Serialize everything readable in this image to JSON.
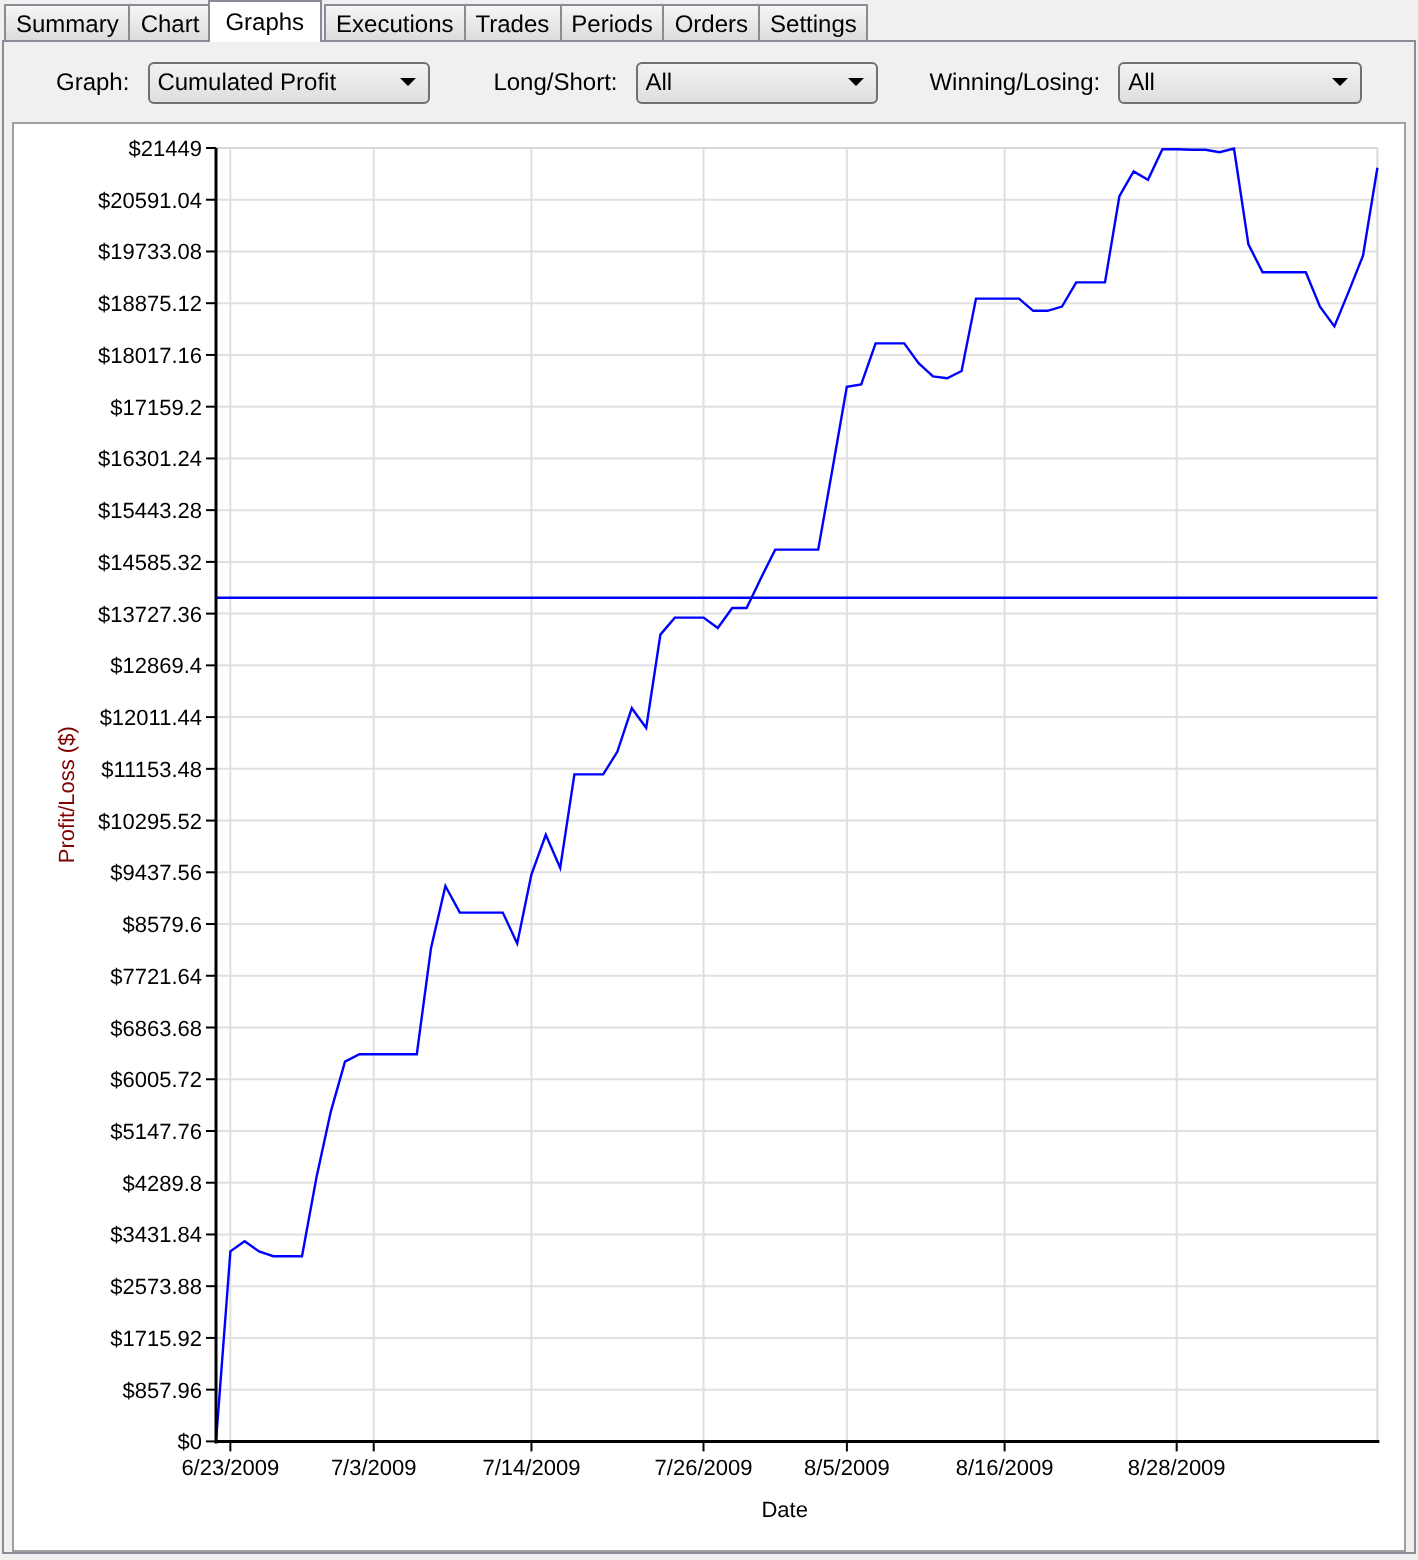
{
  "tabs": [
    {
      "label": "Summary",
      "selected": false
    },
    {
      "label": "Chart",
      "selected": false
    },
    {
      "label": "Graphs",
      "selected": true
    },
    {
      "label": "Executions",
      "selected": false
    },
    {
      "label": "Trades",
      "selected": false
    },
    {
      "label": "Periods",
      "selected": false
    },
    {
      "label": "Orders",
      "selected": false
    },
    {
      "label": "Settings",
      "selected": false
    }
  ],
  "filters": [
    {
      "label": "Graph:",
      "value": "Cumulated Profit"
    },
    {
      "label": "Long/Short:",
      "value": "All"
    },
    {
      "label": "Winning/Losing:",
      "value": "All"
    }
  ],
  "chart": {
    "chart_data": {
      "type": "line",
      "xlabel": "Date",
      "ylabel": "Profit/Loss ($)",
      "categories": [
        null,
        "6/23/2009",
        null,
        null,
        null,
        null,
        null,
        null,
        null,
        null,
        null,
        "7/3/2009",
        null,
        null,
        null,
        null,
        null,
        null,
        null,
        null,
        null,
        null,
        "7/14/2009",
        null,
        null,
        null,
        null,
        null,
        null,
        null,
        null,
        null,
        null,
        null,
        "7/26/2009",
        null,
        null,
        null,
        null,
        null,
        null,
        null,
        null,
        null,
        "8/5/2009",
        null,
        null,
        null,
        null,
        null,
        null,
        null,
        null,
        null,
        null,
        "8/16/2009",
        null,
        null,
        null,
        null,
        null,
        null,
        null,
        null,
        null,
        null,
        null,
        "8/28/2009",
        null,
        null,
        null,
        null,
        null,
        null,
        null,
        null,
        null,
        null,
        null,
        null,
        null,
        null
      ],
      "series": [
        {
          "color": "#0000ff",
          "values": [
            0,
            3150,
            3320,
            3150,
            3070,
            3070,
            3070,
            4370,
            5470,
            6300,
            6420,
            6420,
            6420,
            6420,
            6420,
            8180,
            9210,
            8770,
            8770,
            8770,
            8770,
            8260,
            9400,
            10060,
            9510,
            11060,
            11060,
            11060,
            11440,
            12160,
            11830,
            13380,
            13660,
            13660,
            13660,
            13490,
            13820,
            13820,
            14310,
            14790,
            14790,
            14790,
            14790,
            16140,
            17490,
            17530,
            18210,
            18210,
            18210,
            17880,
            17660,
            17630,
            17750,
            18950,
            18950,
            18950,
            18950,
            18750,
            18750,
            18820,
            19220,
            19220,
            19220,
            20650,
            21060,
            20920,
            21430,
            21430,
            21420,
            21420,
            21380,
            21440,
            19850,
            19390,
            19390,
            19390,
            19390,
            18820,
            18490,
            19070,
            19660,
            21120
          ]
        }
      ],
      "ylim": [
        0,
        21449
      ],
      "grid": true,
      "yticks": [
        {
          "value": 0,
          "label": "$0"
        },
        {
          "value": 857.96,
          "label": "$857.96"
        },
        {
          "value": 1715.92,
          "label": "$1715.92"
        },
        {
          "value": 2573.88,
          "label": "$2573.88"
        },
        {
          "value": 3431.84,
          "label": "$3431.84"
        },
        {
          "value": 4289.8,
          "label": "$4289.8"
        },
        {
          "value": 5147.76,
          "label": "$5147.76"
        },
        {
          "value": 6005.72,
          "label": "$6005.72"
        },
        {
          "value": 6863.68,
          "label": "$6863.68"
        },
        {
          "value": 7721.64,
          "label": "$7721.64"
        },
        {
          "value": 8579.6,
          "label": "$8579.6"
        },
        {
          "value": 9437.56,
          "label": "$9437.56"
        },
        {
          "value": 10295.52,
          "label": "$10295.52"
        },
        {
          "value": 11153.48,
          "label": "$11153.48"
        },
        {
          "value": 12011.44,
          "label": "$12011.44"
        },
        {
          "value": 12869.4,
          "label": "$12869.4"
        },
        {
          "value": 13727.36,
          "label": "$13727.36"
        },
        {
          "value": 14585.32,
          "label": "$14585.32"
        },
        {
          "value": 15443.28,
          "label": "$15443.28"
        },
        {
          "value": 16301.24,
          "label": "$16301.24"
        },
        {
          "value": 17159.2,
          "label": "$17159.2"
        },
        {
          "value": 18017.16,
          "label": "$18017.16"
        },
        {
          "value": 18875.12,
          "label": "$18875.12"
        },
        {
          "value": 19733.08,
          "label": "$19733.08"
        },
        {
          "value": 20591.04,
          "label": "$20591.04"
        },
        {
          "value": 21449,
          "label": "$21449"
        }
      ],
      "ref_lines": [
        {
          "axis": "y",
          "value": 13990,
          "color": "#0000ff"
        }
      ]
    }
  }
}
